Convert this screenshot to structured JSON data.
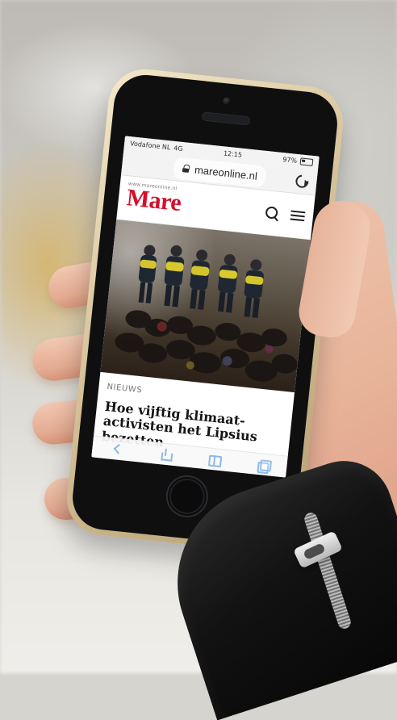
{
  "status_bar": {
    "carrier": "Vodafone NL",
    "network": "4G",
    "time": "12:15",
    "battery": "97%"
  },
  "browser": {
    "url": "mareonline.nl"
  },
  "site": {
    "tagline": "www.mareonline.nl",
    "brand": "Mare",
    "brand_color": "#d5102a"
  },
  "article": {
    "section": "NIEUWS",
    "headline": "Hoe vijftig klimaat-activisten het Lipsius bezetten"
  },
  "toolbar": {
    "icons": [
      "back-icon",
      "share-icon",
      "bookmarks-icon",
      "tabs-icon"
    ]
  }
}
